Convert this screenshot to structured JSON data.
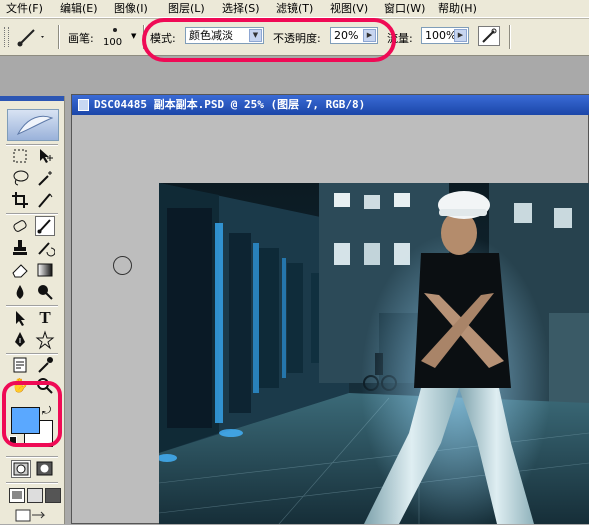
{
  "menu": [
    {
      "label": "文件(F)"
    },
    {
      "label": "编辑(E)"
    },
    {
      "label": "图像(I)"
    },
    {
      "label": "图层(L)"
    },
    {
      "label": "选择(S)"
    },
    {
      "label": "滤镜(T)"
    },
    {
      "label": "视图(V)"
    },
    {
      "label": "窗口(W)"
    },
    {
      "label": "帮助(H)"
    }
  ],
  "options": {
    "brush_label": "画笔:",
    "brush_size": "100",
    "mode_label": "模式:",
    "mode_value": "颜色减淡",
    "opacity_label": "不透明度:",
    "opacity_value": "20%",
    "flow_label": "流量:",
    "flow_value": "100%"
  },
  "document": {
    "title": "DSC04485 副本副本.PSD @ 25% (图层 7, RGB/8)"
  },
  "colors": {
    "foreground": "#5aa8ff",
    "background": "#ffffff",
    "highlight": "#ef0a55"
  },
  "tools": [
    "rect-marquee-icon",
    "move-icon",
    "lasso-icon",
    "magic-wand-icon",
    "crop-icon",
    "slice-icon",
    "healing-brush-icon",
    "brush-icon",
    "clone-stamp-icon",
    "history-brush-icon",
    "eraser-icon",
    "gradient-icon",
    "blur-icon",
    "dodge-icon",
    "path-select-icon",
    "type-icon",
    "pen-icon",
    "shape-icon",
    "notes-icon",
    "eyedropper-icon",
    "hand-icon",
    "zoom-icon"
  ]
}
